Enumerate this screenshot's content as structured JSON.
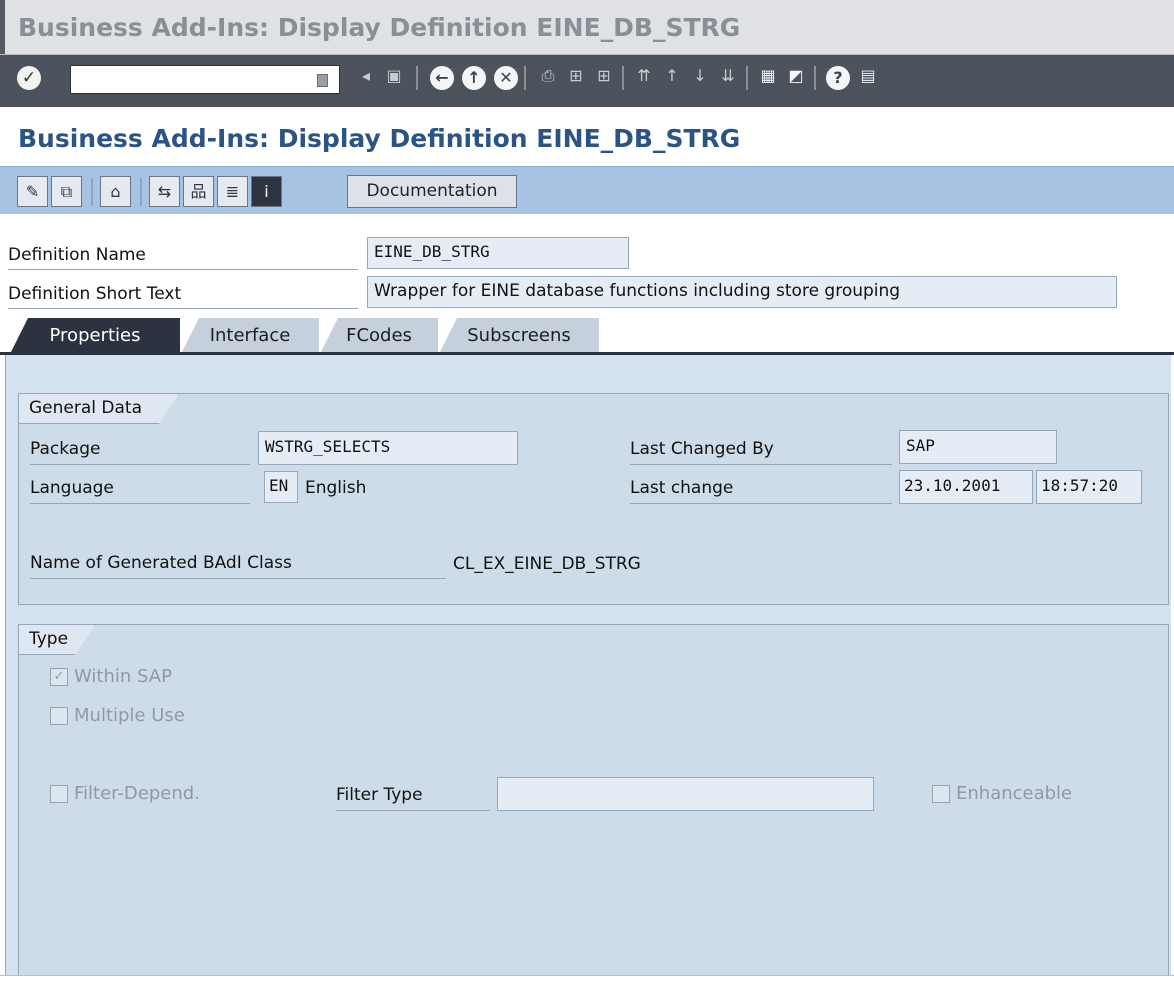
{
  "window": {
    "title": "Business Add-Ins: Display Definition EINE_DB_STRG"
  },
  "system_toolbar": {
    "command_field": {
      "value": "",
      "placeholder": ""
    },
    "icons": [
      "enter-icon",
      "history-icon",
      "back-arrow-icon",
      "save-icon",
      "back-icon",
      "exit-icon",
      "cancel-icon",
      "print-icon",
      "find-icon",
      "find-next-icon",
      "first-page-icon",
      "previous-page-icon",
      "next-page-icon",
      "last-page-icon",
      "create-session-icon",
      "shortcut-icon",
      "help-icon",
      "layout-menu-icon"
    ]
  },
  "screen": {
    "title": "Business Add-Ins: Display Definition EINE_DB_STRG"
  },
  "app_toolbar": {
    "icons": [
      "display-change-icon",
      "other-object-icon",
      "activate-icon",
      "where-used-icon",
      "hierarchy-icon",
      "object-list-icon",
      "info-icon"
    ],
    "documentation_label": "Documentation"
  },
  "definition": {
    "name_label": "Definition Name",
    "name_value": "EINE_DB_STRG",
    "short_text_label": "Definition Short Text",
    "short_text_value": "Wrapper for EINE database functions including store grouping"
  },
  "tabs": [
    {
      "label": "Properties",
      "active": true
    },
    {
      "label": "Interface",
      "active": false
    },
    {
      "label": "FCodes",
      "active": false
    },
    {
      "label": "Subscreens",
      "active": false
    }
  ],
  "general_data": {
    "title": "General Data",
    "package_label": "Package",
    "package_value": "WSTRG_SELECTS",
    "language_label": "Language",
    "language_code": "EN",
    "language_name": "English",
    "last_changed_by_label": "Last Changed By",
    "last_changed_by_value": "SAP",
    "last_change_label": "Last change",
    "last_change_date": "23.10.2001",
    "last_change_time": "18:57:20",
    "badi_class_label": "Name of Generated BAdI Class",
    "badi_class_value": "CL_EX_EINE_DB_STRG"
  },
  "type": {
    "title": "Type",
    "within_sap": {
      "label": "Within SAP",
      "checked": true
    },
    "multiple_use": {
      "label": "Multiple Use",
      "checked": false
    },
    "filter_depend": {
      "label": "Filter-Depend.",
      "checked": false
    },
    "filter_type_label": "Filter Type",
    "filter_type_value": "",
    "enhanceable": {
      "label": "Enhanceable",
      "checked": false
    }
  }
}
